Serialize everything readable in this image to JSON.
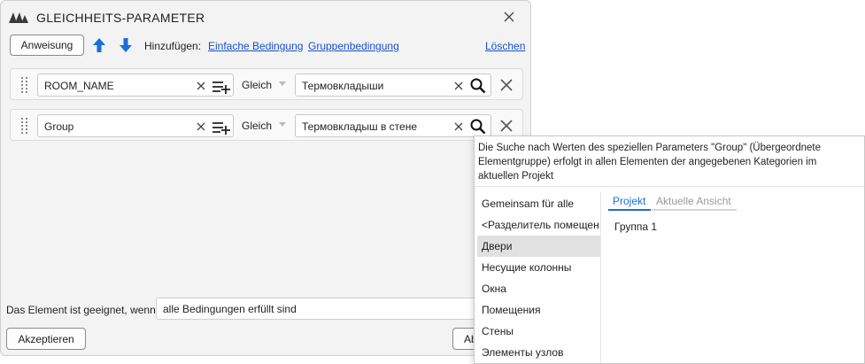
{
  "window": {
    "title": "GLEICHHEITS-PARAMETER"
  },
  "toolbar": {
    "statement_label": "Anweisung",
    "add_label": "Hinzufügen:",
    "simple_condition_link": "Einfache Bedingung",
    "group_condition_link": "Gruppenbedingung",
    "delete_link": "Löschen"
  },
  "conditions": [
    {
      "parameter": "ROOM_NAME",
      "operator": "Gleich",
      "value": "Термовкладыши"
    },
    {
      "parameter": "Group",
      "operator": "Gleich",
      "value": "Термовкладыш в стене"
    }
  ],
  "footer": {
    "eligible_label": "Das Element ist geeignet, wenn",
    "eligible_value": "alle Bedingungen erfüllt sind",
    "accept_label": "Akzeptieren",
    "cancel_label_partial": "Ab"
  },
  "popup": {
    "description": "Die Suche nach Werten des speziellen Parameters \"Group\" (Übergeordnete Elementgruppe) erfolgt in allen Elementen der angegebenen Kategorien im aktuellen Projekt",
    "categories": [
      "Gemeinsam für alle",
      "<Разделитель помещен",
      "Двери",
      "Несущие колонны",
      "Окна",
      "Помещения",
      "Стены",
      "Элементы узлов"
    ],
    "selected_category_index": 2,
    "tabs": [
      "Projekt",
      "Aktuelle Ansicht"
    ],
    "active_tab": "Projekt",
    "values": [
      "Группа 1"
    ]
  },
  "colors": {
    "accent": "#1a6fd6",
    "link": "#1a4fd0",
    "selected_bg": "#e1e1e1",
    "inactive_tab": "#9a9a9a"
  }
}
